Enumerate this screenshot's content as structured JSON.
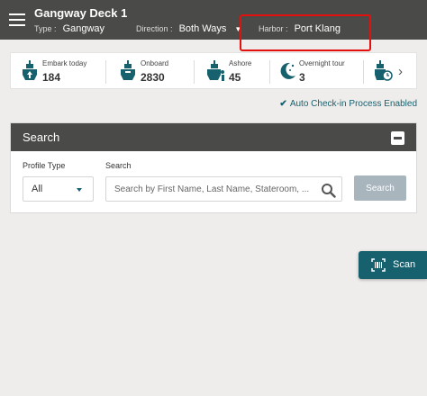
{
  "header": {
    "title": "Gangway Deck 1",
    "type_label": "Type :",
    "type_value": "Gangway",
    "direction_label": "Direction :",
    "direction_value": "Both Ways",
    "harbor_label": "Harbor :",
    "harbor_value": "Port Klang",
    "highlight_color": "#e3100e"
  },
  "stats": [
    {
      "label": "Embark today",
      "value": "184",
      "icon": "ship-up-icon"
    },
    {
      "label": "Onboard",
      "value": "2830",
      "icon": "ship-icon"
    },
    {
      "label": "Ashore",
      "value": "45",
      "icon": "ship-person-icon"
    },
    {
      "label": "Overnight tour",
      "value": "3",
      "icon": "moon-stars-icon"
    },
    {
      "label": "",
      "value": "",
      "icon": "ship-clock-icon"
    }
  ],
  "auto_checkin": "Auto Check-in Process Enabled",
  "search": {
    "title": "Search",
    "profile_type_label": "Profile Type",
    "profile_type_value": "All",
    "search_label": "Search",
    "search_placeholder": "Search by First Name, Last Name, Stateroom, ...",
    "search_button": "Search"
  },
  "scan": {
    "label": "Scan"
  },
  "colors": {
    "header_bg": "#4a4a48",
    "accent": "#17606e",
    "background": "#efedeb",
    "disabled_button": "#a9b5bd"
  }
}
